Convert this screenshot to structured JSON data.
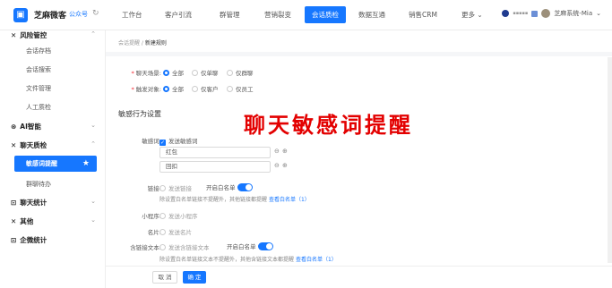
{
  "topbar": {
    "brand": "芝麻微客",
    "brand_sub": "公众号",
    "tabs": [
      "工作台",
      "客户引流",
      "群管理",
      "营销裂变",
      "会话质检",
      "数据互通",
      "销售CRM",
      "更多"
    ],
    "active_tab": "会话质检",
    "user": "芝麻系统-Mia"
  },
  "sidebar": {
    "group_risk": "风险管控",
    "risk_items": [
      "会话存档",
      "会话搜索",
      "文件管理",
      "人工质检"
    ],
    "group_ai": "AI智能",
    "group_chat_qc": "聊天质检",
    "active_item": "敏感词提醒",
    "qc_item_2": "群聊待办",
    "group_chat_stats": "聊天统计",
    "group_other": "其他",
    "group_wecom_stats": "企微统计"
  },
  "breadcrumb": {
    "parent": "会话提醒",
    "current": "新建规则"
  },
  "scene": {
    "label": "聊天场景:",
    "options": [
      "全部",
      "仅单聊",
      "仅群聊"
    ]
  },
  "trigger": {
    "label": "触发对象:",
    "options": [
      "全部",
      "仅客户",
      "仅员工"
    ]
  },
  "section_title": "敏感行为设置",
  "sensitive": {
    "label": "敏感词:",
    "checkbox": "发送敏感词",
    "inputs": [
      "红包",
      "回扣"
    ]
  },
  "link": {
    "label": "链接:",
    "option": "发送链接",
    "whitelist": "开启白名单",
    "hint": "除设置白名单链接不提醒外，其他链接都提醒",
    "hint_link": "查看白名单（1）"
  },
  "miniapp": {
    "label": "小程序:",
    "option": "发送小程序"
  },
  "card": {
    "label": "名片:",
    "option": "发送名片"
  },
  "linktext": {
    "label": "含链接文本:",
    "option": "发送含链接文本",
    "whitelist": "开启白名单",
    "hint": "除设置白名单链接文本不提醒外，其他含链接文本都提醒",
    "hint_link": "查看白名单（1）"
  },
  "footer": {
    "cancel": "取 消",
    "ok": "确 定"
  },
  "overlay_title": "聊天敏感词提醒"
}
